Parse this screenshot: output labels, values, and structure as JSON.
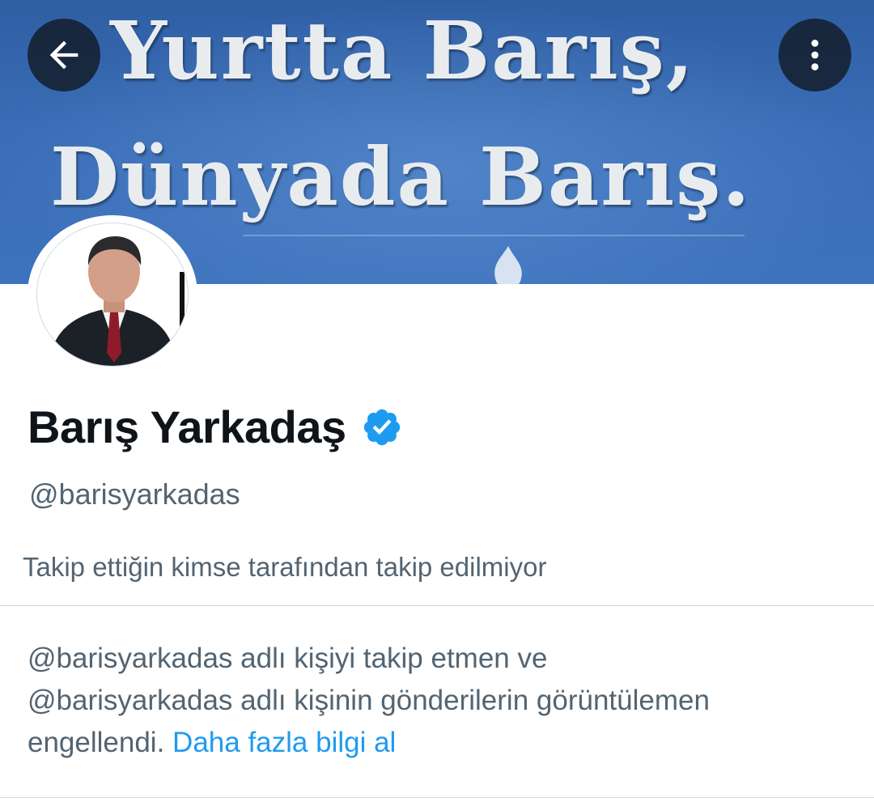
{
  "banner": {
    "line1": "Yurtta Barış,",
    "line2": "Dünyada Barış."
  },
  "header": {
    "back_icon": "arrow-left-icon",
    "more_icon": "more-vertical-icon"
  },
  "profile": {
    "display_name": "Barış Yarkadaş",
    "verified_icon": "verified-badge-icon",
    "verified_color": "#1d9bf0",
    "handle": "@barisyarkadas",
    "followed_by_text": "Takip ettiğin kimse tarafından takip edilmiyor"
  },
  "blocked_notice": {
    "line1": "@barisyarkadas adlı kişiyi takip etmen ve",
    "line2": "@barisyarkadas adlı kişinin gönderilerin görüntülemen",
    "line3": "engellendi.",
    "learn_more_link": "Daha fazla bilgi al"
  }
}
